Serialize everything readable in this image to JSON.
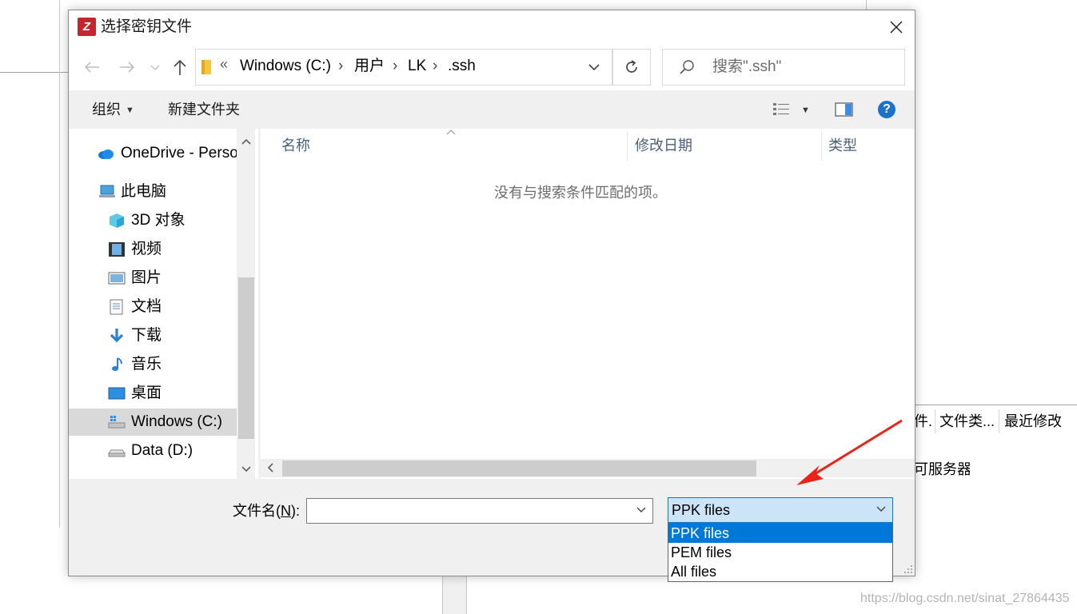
{
  "background_app": {
    "columns": [
      "件...",
      "文件类...",
      "最近修改"
    ],
    "row_text": "可服务器"
  },
  "dialog": {
    "title": "选择密钥文件",
    "app_icon_letter": "Z",
    "address": {
      "overflow": "«",
      "crumbs": [
        "Windows (C:)",
        "用户",
        "LK",
        ".ssh"
      ],
      "separator": "›"
    },
    "search": {
      "placeholder": "搜索\".ssh\""
    },
    "toolbar": {
      "organize": "组织",
      "new_folder": "新建文件夹"
    },
    "nav": {
      "items": [
        {
          "label": "OneDrive - Perso",
          "icon": "onedrive-icon"
        },
        {
          "label": "此电脑",
          "icon": "pc-icon"
        },
        {
          "label": "3D 对象",
          "icon": "3d-objects-icon"
        },
        {
          "label": "视频",
          "icon": "video-icon"
        },
        {
          "label": "图片",
          "icon": "pictures-icon"
        },
        {
          "label": "文档",
          "icon": "documents-icon"
        },
        {
          "label": "下载",
          "icon": "download-icon"
        },
        {
          "label": "音乐",
          "icon": "music-icon"
        },
        {
          "label": "桌面",
          "icon": "desktop-icon"
        },
        {
          "label": "Windows (C:)",
          "icon": "windows-drive-icon",
          "selected": true
        },
        {
          "label": "Data (D:)",
          "icon": "drive-icon"
        }
      ]
    },
    "file_list": {
      "columns": [
        "名称",
        "修改日期",
        "类型"
      ],
      "empty_message": "没有与搜索条件匹配的项。"
    },
    "bottom": {
      "filename_label_prefix": "文件名(",
      "filename_label_key": "N",
      "filename_label_suffix": "):",
      "filename_value": "",
      "file_type_selected": "PPK files",
      "file_type_options": [
        "PPK files",
        "PEM files",
        "All files"
      ]
    }
  },
  "annotation": {
    "color": "#e8231a"
  },
  "watermark": "https://blog.csdn.net/sinat_27864435"
}
